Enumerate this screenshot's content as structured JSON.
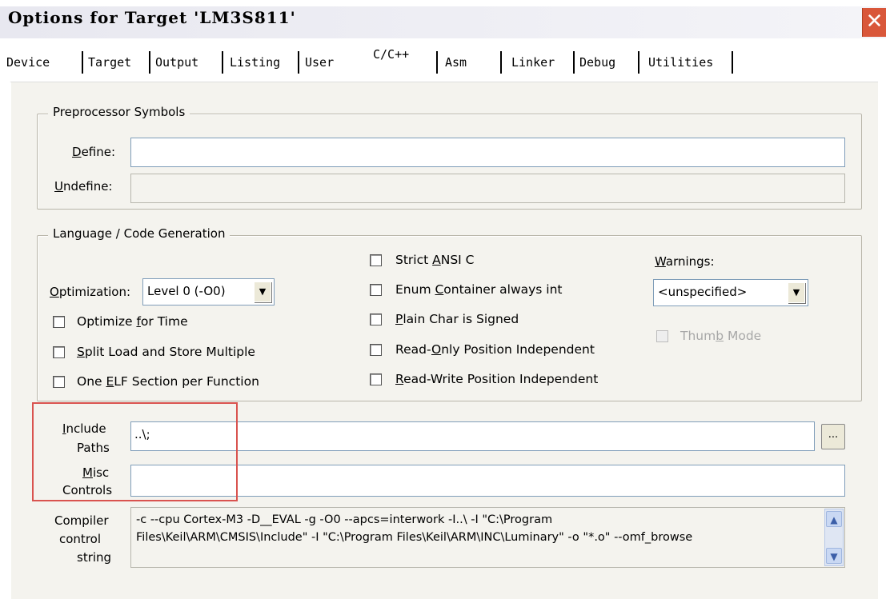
{
  "window": {
    "title": "Options for Target 'LM3S811'",
    "close_glyph": "✕"
  },
  "tabs": [
    {
      "label": "Device"
    },
    {
      "label": "Target"
    },
    {
      "label": "Output"
    },
    {
      "label": "Listing"
    },
    {
      "label": "User"
    },
    {
      "label": "C/C++",
      "active": true
    },
    {
      "label": "Asm"
    },
    {
      "label": "Linker"
    },
    {
      "label": "Debug"
    },
    {
      "label": "Utilities"
    }
  ],
  "preprocessor": {
    "legend": "Preprocessor Symbols",
    "define_label": "Define:",
    "define_value": "",
    "undefine_label": "Undefine:",
    "undefine_value": ""
  },
  "codegen": {
    "legend": "Language / Code Generation",
    "optimization_label": "Optimization:",
    "optimization_value": "Level 0 (-O0)",
    "optimize_time": {
      "label": "Optimize for Time",
      "checked": false
    },
    "split_load": {
      "label": "Split Load and Store Multiple",
      "checked": false
    },
    "one_elf": {
      "label": "One ELF Section per Function",
      "checked": false
    },
    "strict_ansi": {
      "label": "Strict ANSI C",
      "checked": false
    },
    "enum_container": {
      "label": "Enum Container always int",
      "checked": false
    },
    "plain_char": {
      "label": "Plain Char is Signed",
      "checked": false
    },
    "ro_pi": {
      "label": "Read-Only Position Independent",
      "checked": false
    },
    "rw_pi": {
      "label": "Read-Write Position Independent",
      "checked": false
    },
    "warnings_label": "Warnings:",
    "warnings_value": "<unspecified>",
    "thumb_mode": {
      "label": "Thumb Mode",
      "checked": false,
      "disabled": true
    }
  },
  "include": {
    "label_line1": "Include",
    "label_line2": "Paths",
    "value": "..\\;",
    "browse_label": "..."
  },
  "misc": {
    "label_line1": "Misc",
    "label_line2": "Controls",
    "value": ""
  },
  "compiler": {
    "label_line1": "Compiler",
    "label_line2": "control",
    "label_line3": "string",
    "line1": "-c --cpu Cortex-M3 -D__EVAL -g -O0 --apcs=interwork -I..\\ -I \"C:\\Program",
    "line2": "Files\\Keil\\ARM\\CMSIS\\Include\" -I \"C:\\Program Files\\Keil\\ARM\\INC\\Luminary\" -o \"*.o\" --omf_browse"
  },
  "colors": {
    "dialog_bg": "#f4f3ee",
    "highlight_box": "#d9534f",
    "close_button": "#d9573a"
  }
}
